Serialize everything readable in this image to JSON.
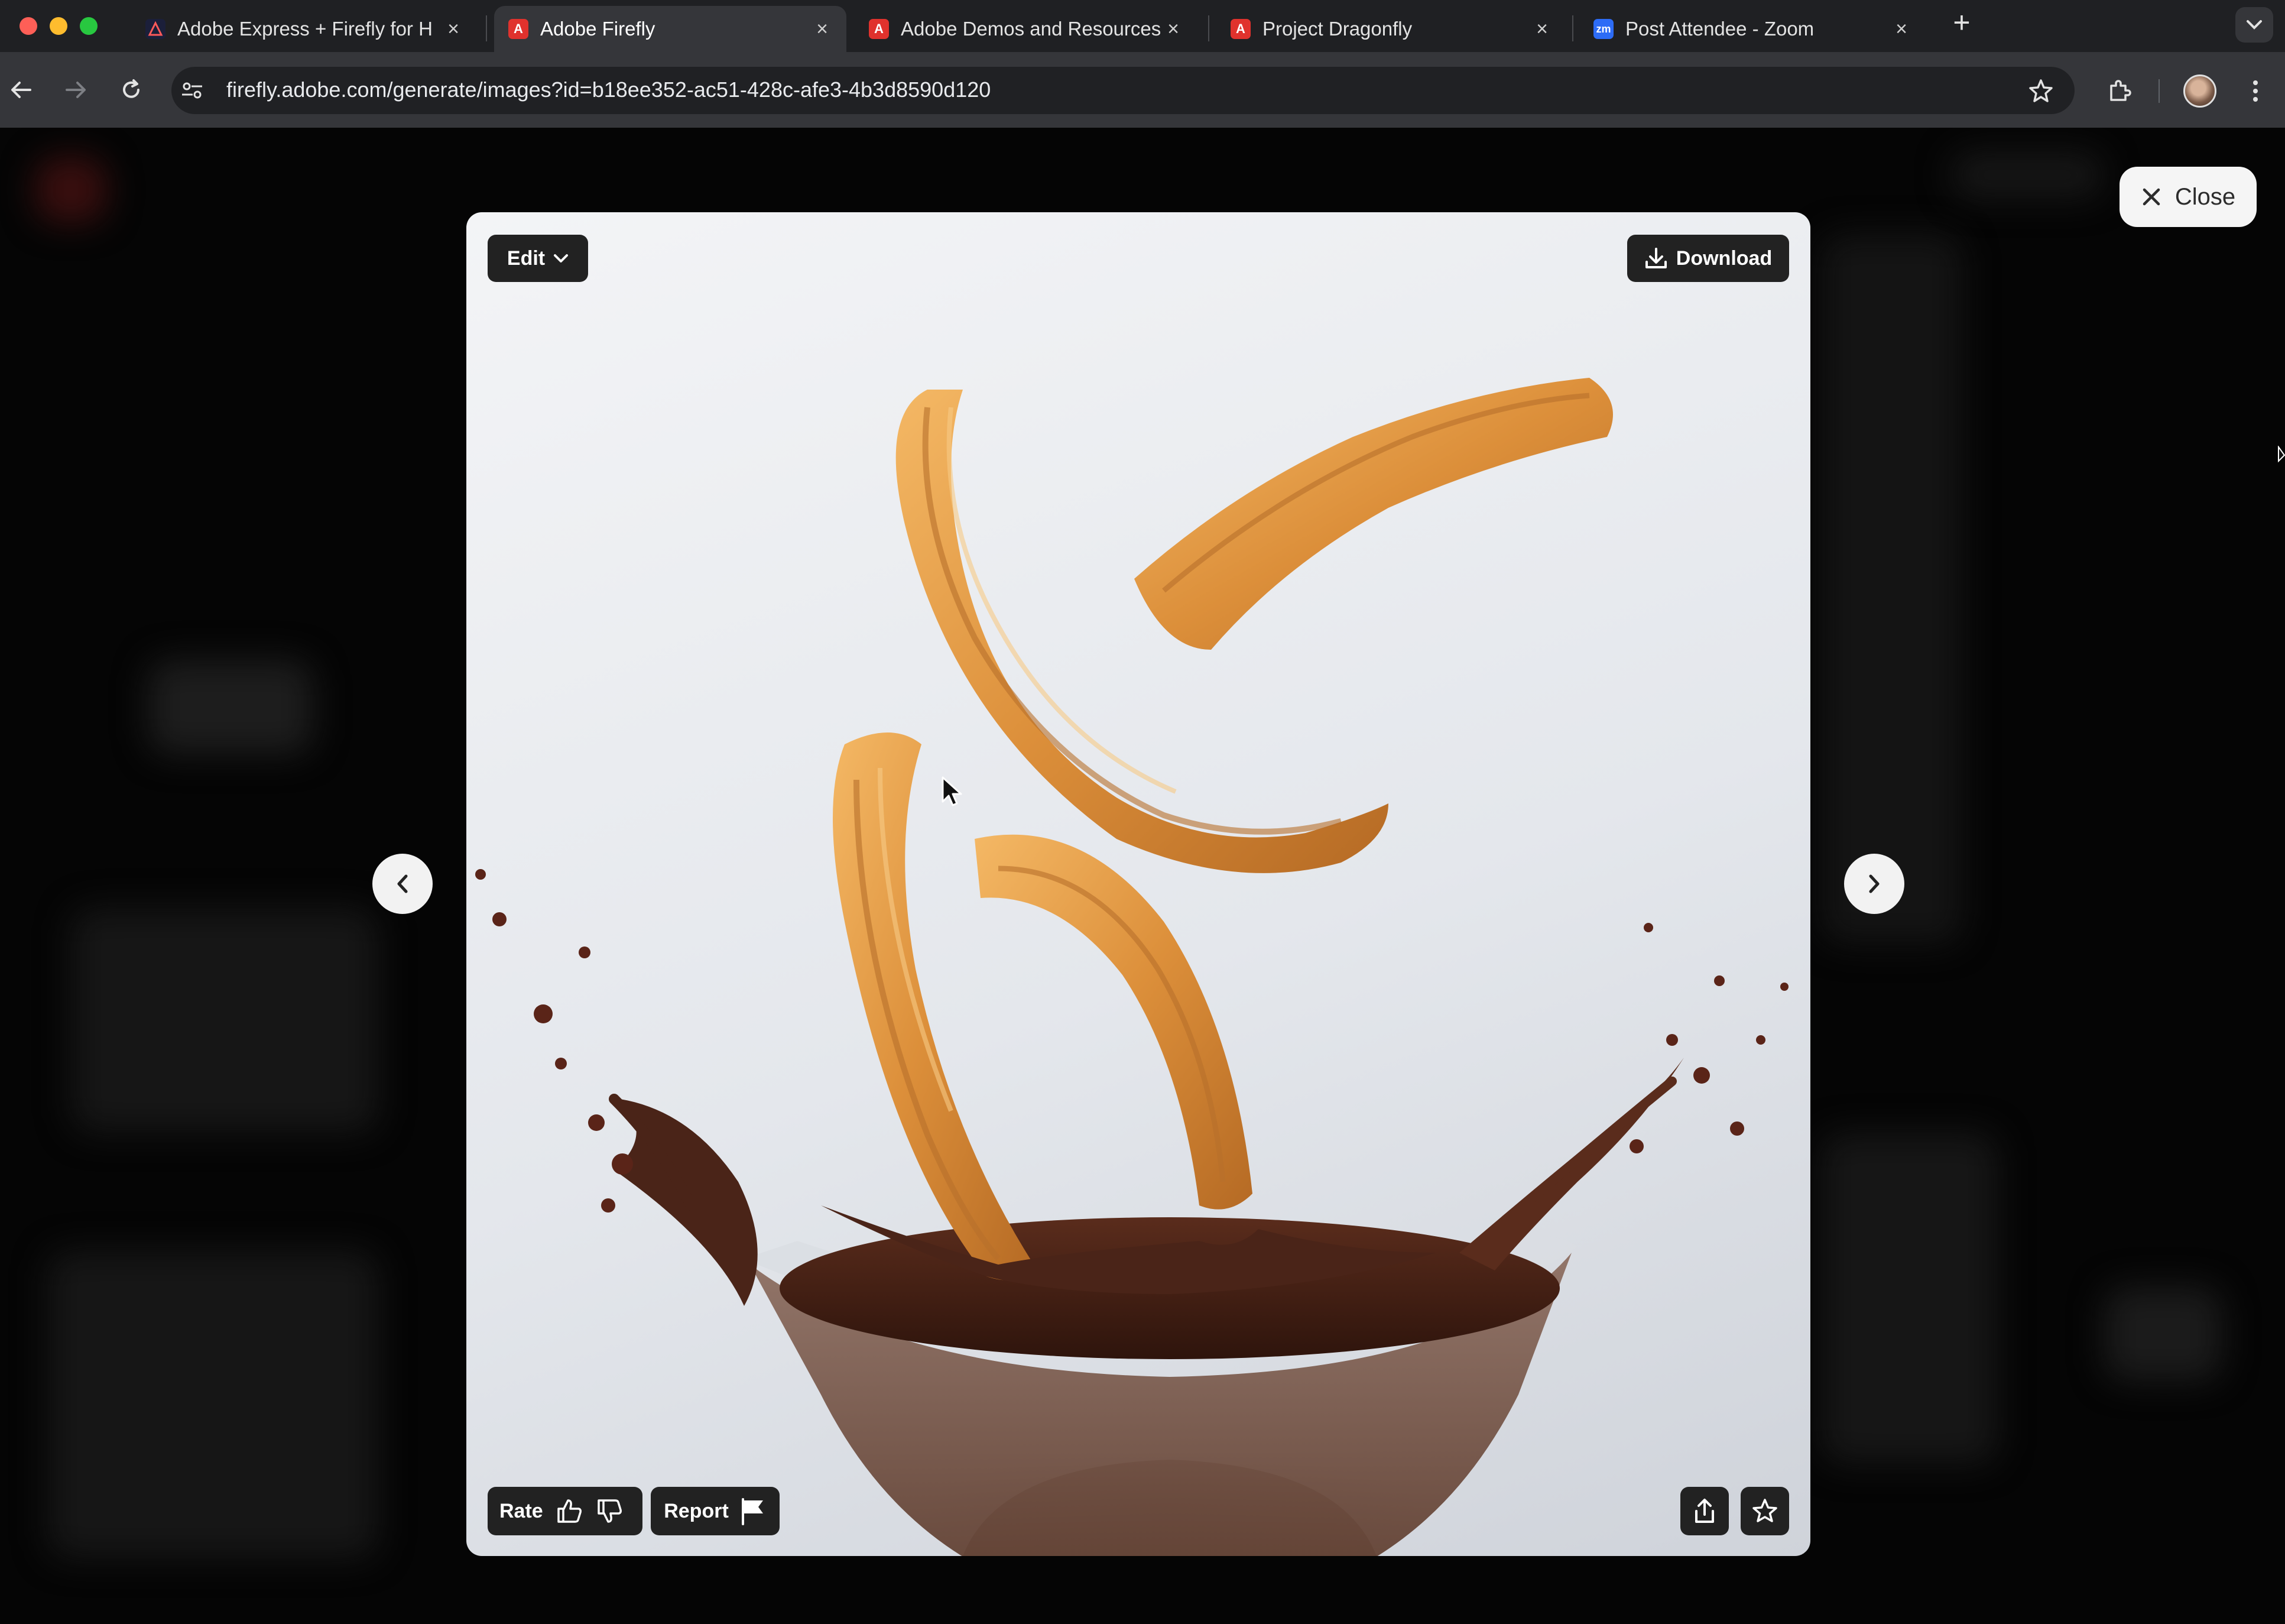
{
  "browser": {
    "tabs": [
      {
        "title": "Adobe Express + Firefly for H",
        "favicon": "adobe-express-icon",
        "favicon_color": "#1b1f3a",
        "active": false
      },
      {
        "title": "Adobe Firefly",
        "favicon": "adobe-icon",
        "favicon_color": "#e0322d",
        "active": true
      },
      {
        "title": "Adobe Demos and Resources",
        "favicon": "adobe-icon",
        "favicon_color": "#e0322d",
        "active": false
      },
      {
        "title": "Project Dragonfly",
        "favicon": "adobe-icon",
        "favicon_color": "#e0322d",
        "active": false
      },
      {
        "title": "Post Attendee - Zoom",
        "favicon": "zoom-icon",
        "favicon_color": "#2d6cf6",
        "favicon_text": "zm",
        "active": false
      }
    ],
    "url": "firefly.adobe.com/generate/images?id=b18ee352-ac51-428c-afe3-4b3d8590d120"
  },
  "viewer": {
    "close_label": "Close",
    "edit_label": "Edit",
    "download_label": "Download",
    "rate_label": "Rate",
    "report_label": "Report",
    "image_subject": "churros splashing into chocolate bowl"
  },
  "colors": {
    "tabbar_bg": "#1f2023",
    "toolbar_bg": "#35363a",
    "overlay_bg": "#050505",
    "button_dark": "#222222",
    "churro": "#e2a04e",
    "chocolate": "#4a2418"
  }
}
